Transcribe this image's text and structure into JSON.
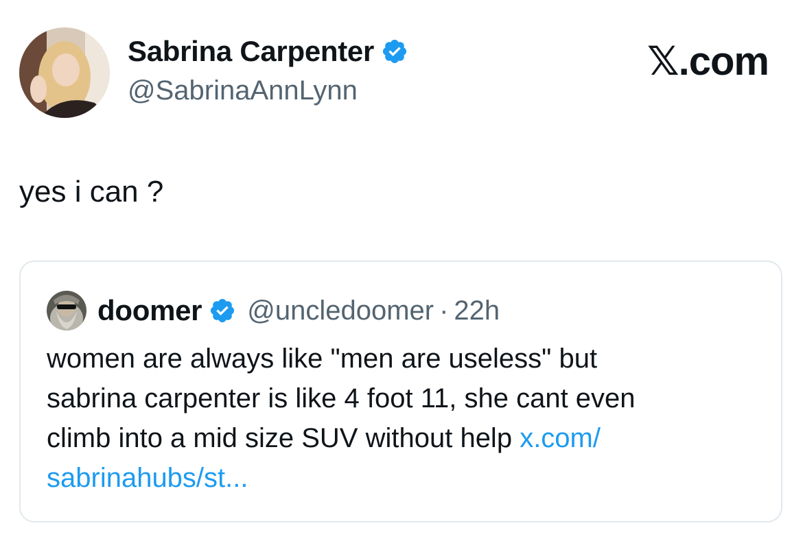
{
  "author": {
    "display_name": "Sabrina Carpenter",
    "handle": "@SabrinaAnnLynn",
    "verified": true,
    "avatar": "profile-photo"
  },
  "brand": {
    "label": "𝕏.com"
  },
  "tweet": {
    "text": "yes i can ?"
  },
  "quoted_tweet": {
    "display_name": "doomer",
    "verified": true,
    "handle": "@uncledoomer",
    "separator": "·",
    "time": "22h",
    "text_lines": [
      "women are always like \"men are useless\" but",
      "sabrina carpenter is like 4 foot 11, she cant even",
      "climb into a mid size SUV without help "
    ],
    "link_line1": "x.com/",
    "link_line2": "sabrinahubs/st..."
  },
  "colors": {
    "verified_badge": "#1d9bf0",
    "link": "#1d9bf0",
    "secondary_text": "#536471",
    "border": "#e1e8ed"
  }
}
